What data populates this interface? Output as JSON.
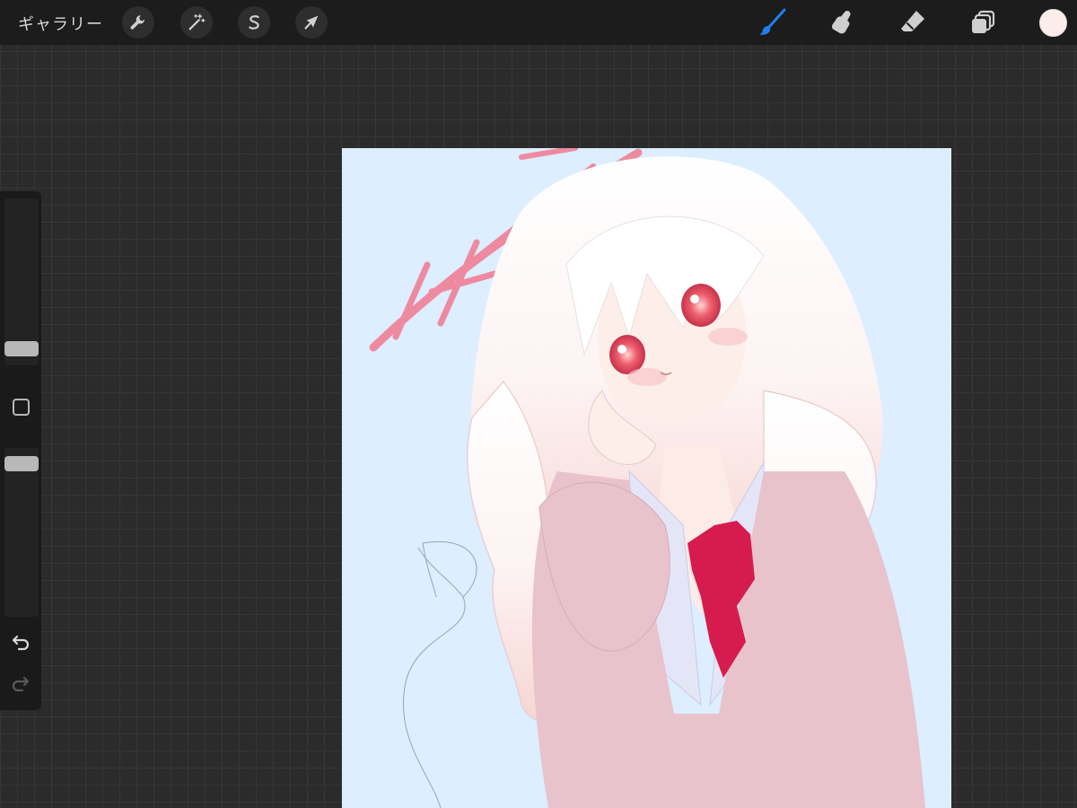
{
  "topbar": {
    "gallery_label": "ギャラリー",
    "left_tools": [
      {
        "name": "actions",
        "icon": "wrench-icon"
      },
      {
        "name": "adjustments",
        "icon": "magic-wand-icon"
      },
      {
        "name": "selection",
        "icon": "selection-s-icon"
      },
      {
        "name": "transform",
        "icon": "arrow-cursor-icon"
      }
    ],
    "right_tools": [
      {
        "name": "brush",
        "icon": "brush-icon",
        "active": true
      },
      {
        "name": "smudge",
        "icon": "smudge-finger-icon",
        "active": false
      },
      {
        "name": "eraser",
        "icon": "eraser-icon",
        "active": false
      },
      {
        "name": "layers",
        "icon": "layers-icon",
        "active": false
      }
    ],
    "current_color": "#fbeeea"
  },
  "sidebar": {
    "brush_size": 0.06,
    "opacity": 0.95,
    "icons": [
      "modify-square-icon",
      "undo-icon",
      "redo-icon"
    ]
  },
  "theme": {
    "accent": "#1f7ef0",
    "canvas_bg": "#dceeff",
    "halo_pink": "#ee8aa0",
    "tie_red": "#d61c4e",
    "sweater_pink": "#e8c3cb"
  }
}
